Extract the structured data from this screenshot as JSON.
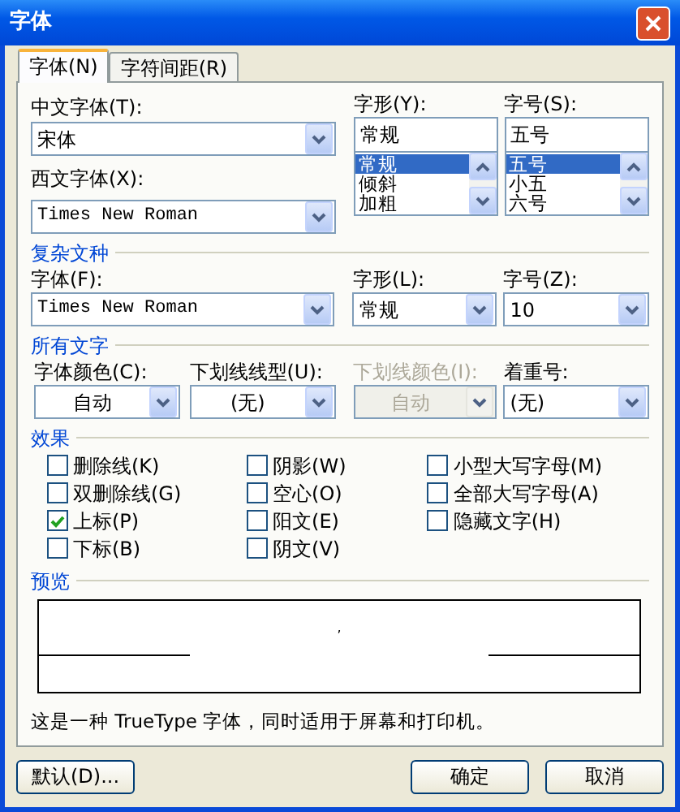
{
  "window": {
    "title": "字体"
  },
  "tabs": [
    {
      "label": "字体(N)",
      "selected": true
    },
    {
      "label": "字符间距(R)",
      "selected": false
    }
  ],
  "chinese_font": {
    "label": "中文字体(T):",
    "value": "宋体"
  },
  "latin_font": {
    "label": "西文字体(X):",
    "value": "Times New Roman"
  },
  "font_style": {
    "label": "字形(Y):",
    "value": "常规",
    "options": [
      {
        "label": "常规",
        "selected": true
      },
      {
        "label": "倾斜",
        "selected": false
      },
      {
        "label": "加粗",
        "selected": false
      }
    ]
  },
  "font_size": {
    "label": "字号(S):",
    "value": "五号",
    "options": [
      {
        "label": "五号",
        "selected": true
      },
      {
        "label": "小五",
        "selected": false
      },
      {
        "label": "六号",
        "selected": false
      }
    ]
  },
  "complex_script": {
    "heading": "复杂文种",
    "fields": [
      {
        "label": "字体(F):",
        "value": "Times New Roman",
        "disabled": false
      },
      {
        "label": "字形(L):",
        "value": "常规",
        "disabled": false
      },
      {
        "label": "字号(Z):",
        "value": "10",
        "disabled": false
      }
    ]
  },
  "all_text": {
    "heading": "所有文字",
    "fields": [
      {
        "label": "字体颜色(C):",
        "value": "自动",
        "disabled": false
      },
      {
        "label": "下划线线型(U):",
        "value": "(无)",
        "disabled": false
      },
      {
        "label": "下划线颜色(I):",
        "value": "自动",
        "disabled": true
      },
      {
        "label": "着重号:",
        "value": "(无)",
        "disabled": false
      }
    ]
  },
  "effects": {
    "heading": "效果",
    "columns": [
      [
        {
          "label": "删除线(K)",
          "checked": false
        },
        {
          "label": "双删除线(G)",
          "checked": false
        },
        {
          "label": "上标(P)",
          "checked": true
        },
        {
          "label": "下标(B)",
          "checked": false
        }
      ],
      [
        {
          "label": "阴影(W)",
          "checked": false
        },
        {
          "label": "空心(O)",
          "checked": false
        },
        {
          "label": "阳文(E)",
          "checked": false
        },
        {
          "label": "阴文(V)",
          "checked": false
        }
      ],
      [
        {
          "label": "小型大写字母(M)",
          "checked": false
        },
        {
          "label": "全部大写字母(A)",
          "checked": false
        },
        {
          "label": "隐藏文字(H)",
          "checked": false
        }
      ]
    ]
  },
  "preview": {
    "heading": "预览",
    "sample": ","
  },
  "note": "这是一种 TrueType 字体，同时适用于屏幕和打印机。",
  "buttons": [
    {
      "label": "默认(D)..."
    },
    {
      "label": "确定"
    },
    {
      "label": "取消"
    }
  ]
}
